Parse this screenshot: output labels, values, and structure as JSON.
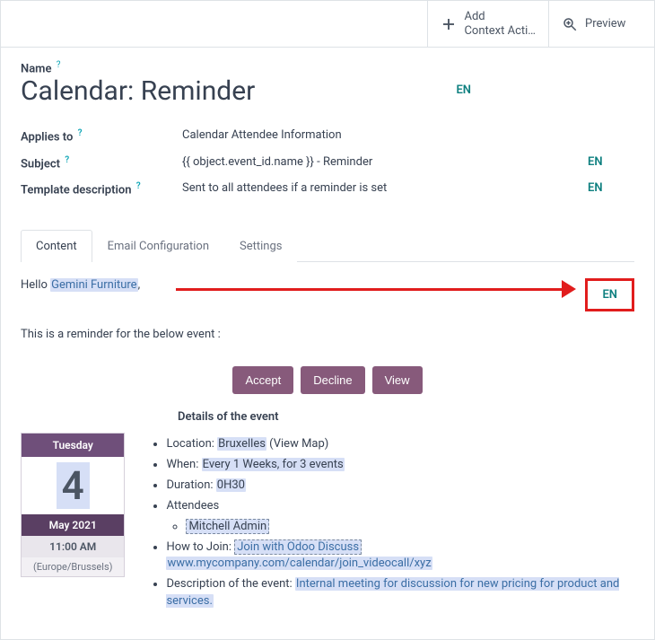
{
  "topbar": {
    "add_context_label": "Add\nContext Acti…",
    "preview_label": "Preview"
  },
  "name": {
    "label": "Name",
    "value": "Calendar: Reminder",
    "en": "EN"
  },
  "fields": {
    "applies_to": {
      "label": "Applies to",
      "value": "Calendar Attendee Information"
    },
    "subject": {
      "label": "Subject",
      "value": "{{ object.event_id.name }} - Reminder",
      "en": "EN"
    },
    "desc": {
      "label": "Template description",
      "value": "Sent to all attendees if a reminder is set",
      "en": "EN"
    }
  },
  "tabs": {
    "content": "Content",
    "email_config": "Email Configuration",
    "settings": "Settings"
  },
  "body": {
    "hello_prefix": "Hello ",
    "hello_name": "Gemini Furniture",
    "hello_suffix": ",",
    "en": "EN",
    "reminder_line": "This is a reminder for the below event :",
    "btn_accept": "Accept",
    "btn_decline": "Decline",
    "btn_view": "View",
    "details_title": "Details of the event",
    "cal": {
      "dow": "Tuesday",
      "dom": "4",
      "mon": "May 2021",
      "time": "11:00 AM",
      "tz": "(Europe/Brussels)"
    },
    "evt": {
      "location_label": "Location: ",
      "location_value": "Bruxelles",
      "view_map": " (View Map)",
      "when_label": "When: ",
      "when_value": "Every 1 Weeks, for 3 events",
      "duration_label": "Duration: ",
      "duration_value": "0H30",
      "attendees_label": "Attendees",
      "attendee_1": "Mitchell Admin",
      "how_label": "How to Join: ",
      "how_value": "Join with Odoo Discuss",
      "join_url": "www.mycompany.com/calendar/join_videocall/xyz",
      "desc_label": "Description of the event: ",
      "desc_value": "Internal meeting for discussion for new pricing for product and services."
    }
  }
}
